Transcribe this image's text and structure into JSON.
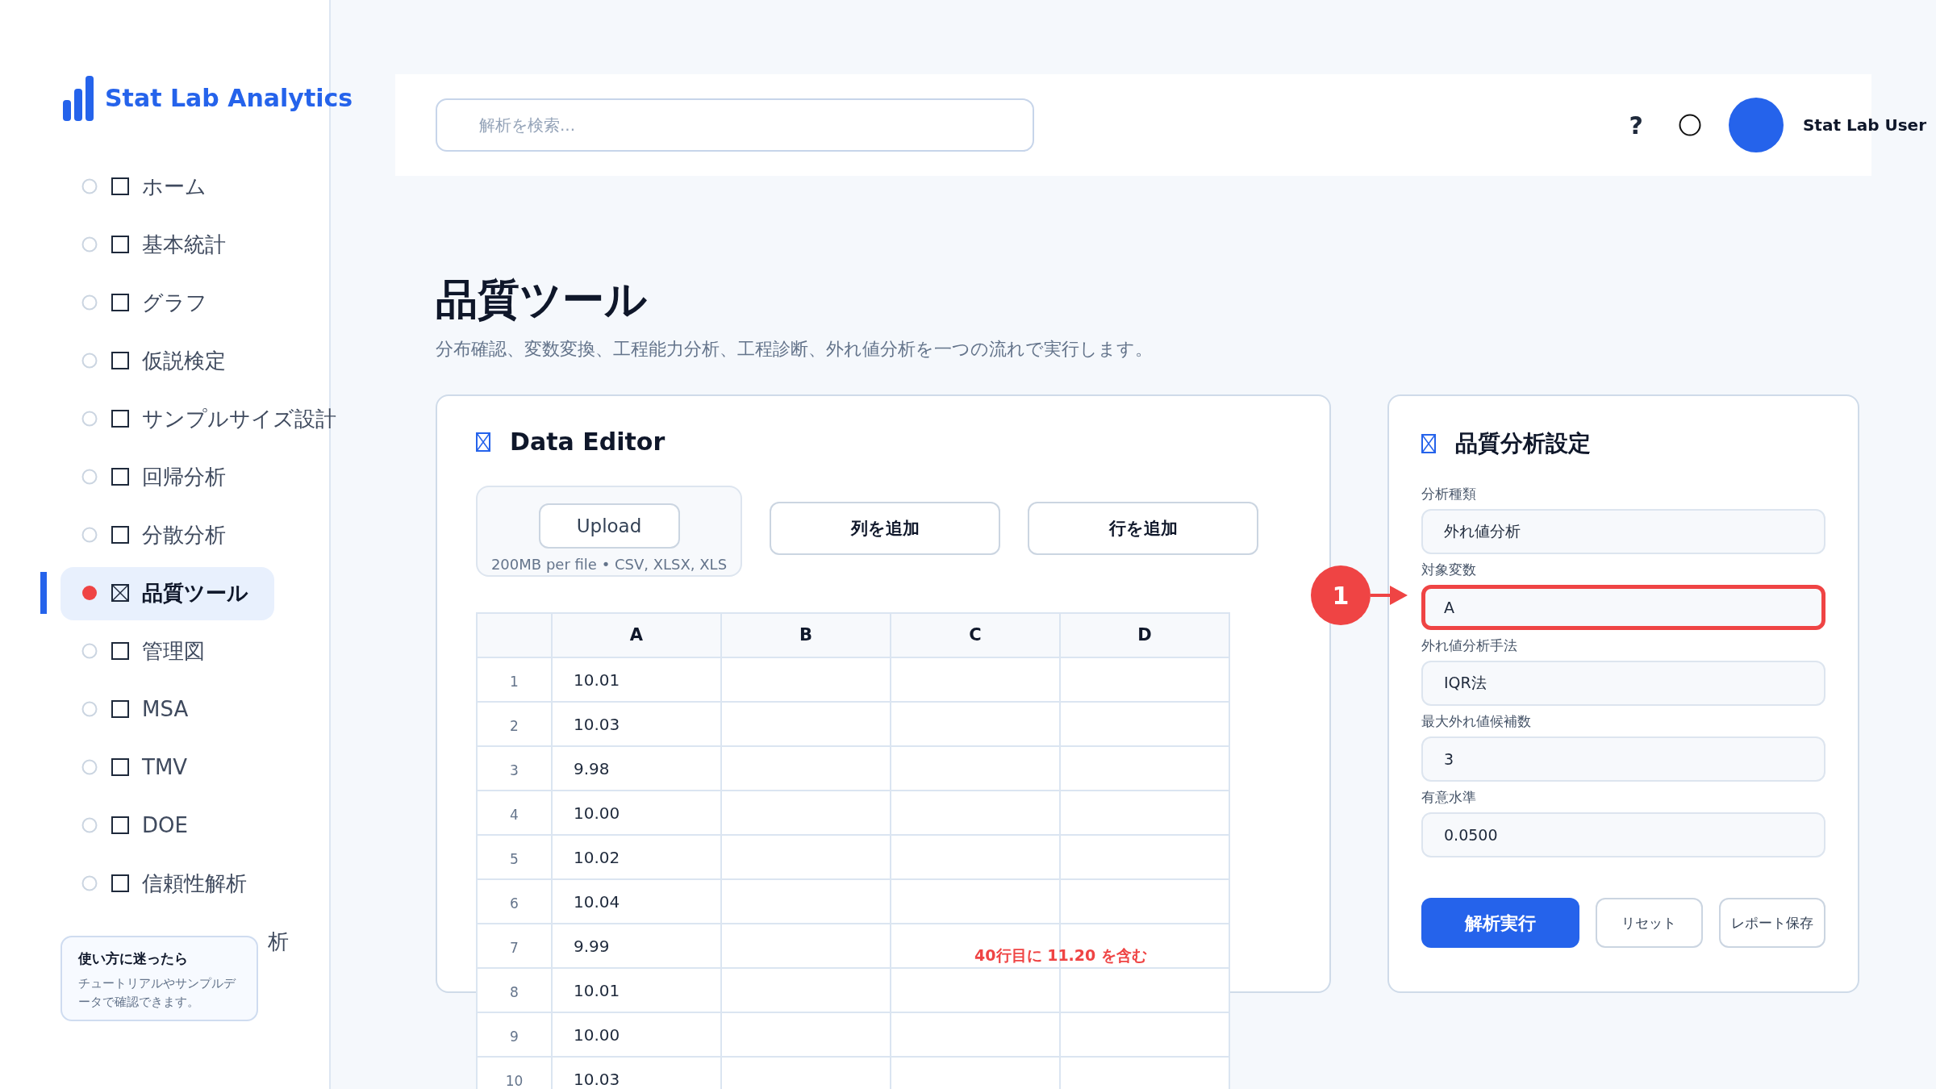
{
  "app": {
    "name": "Stat Lab Analytics"
  },
  "sidebar": {
    "items": [
      {
        "label": "ホーム",
        "selected": false
      },
      {
        "label": "基本統計",
        "selected": false
      },
      {
        "label": "グラフ",
        "selected": false
      },
      {
        "label": "仮説検定",
        "selected": false
      },
      {
        "label": "サンプルサイズ設計",
        "selected": false
      },
      {
        "label": "回帰分析",
        "selected": false
      },
      {
        "label": "分散分析",
        "selected": false
      },
      {
        "label": "品質ツール",
        "selected": true
      },
      {
        "label": "管理図",
        "selected": false
      },
      {
        "label": "MSA",
        "selected": false
      },
      {
        "label": "TMV",
        "selected": false
      },
      {
        "label": "DOE",
        "selected": false
      },
      {
        "label": "信頼性解析",
        "selected": false
      },
      {
        "label": "析",
        "selected": false,
        "covered": true
      }
    ],
    "help": {
      "title": "使い方に迷ったら",
      "text": "チュートリアルやサンプルデータで確認できます。"
    }
  },
  "topbar": {
    "search": {
      "placeholder": "解析を検索..."
    },
    "help": "?",
    "user": "Stat Lab User"
  },
  "page": {
    "title": "品質ツール",
    "subtitle": "分布確認、変数変換、工程能力分析、工程診断、外れ値分析を一つの流れで実行します。"
  },
  "editor": {
    "title": "Data Editor",
    "upload": {
      "button": "Upload",
      "hint": "200MB per file • CSV, XLSX, XLS"
    },
    "buttons": [
      "列を追加",
      "行を追加"
    ],
    "table": {
      "columns": [
        "A",
        "B",
        "C",
        "D"
      ],
      "rows": [
        {
          "n": "1",
          "cells": [
            "10.01"
          ]
        },
        {
          "n": "2",
          "cells": [
            "10.03"
          ]
        },
        {
          "n": "3",
          "cells": [
            "9.98"
          ]
        },
        {
          "n": "4",
          "cells": [
            "10.00"
          ]
        },
        {
          "n": "5",
          "cells": [
            "10.02"
          ]
        },
        {
          "n": "6",
          "cells": [
            "10.04"
          ]
        },
        {
          "n": "7",
          "cells": [
            "9.99"
          ],
          "note": "40行目に 11.20 を含む"
        },
        {
          "n": "8",
          "cells": [
            "10.01"
          ]
        },
        {
          "n": "9",
          "cells": [
            "10.00"
          ]
        },
        {
          "n": "10",
          "cells": [
            "10.03"
          ]
        }
      ]
    }
  },
  "settings": {
    "title": "品質分析設定",
    "fields": [
      {
        "label": "分析種類",
        "value": "外れ値分析",
        "highlighted": false
      },
      {
        "label": "対象変数",
        "value": "A",
        "highlighted": true
      },
      {
        "label": "外れ値分析手法",
        "value": "IQR法",
        "highlighted": false
      },
      {
        "label": "最大外れ値候補数",
        "value": "3",
        "highlighted": false
      },
      {
        "label": "有意水準",
        "value": "0.0500",
        "highlighted": false
      }
    ],
    "buttons": [
      {
        "label": "解析実行",
        "kind": "primary"
      },
      {
        "label": "リセット",
        "kind": "outline"
      },
      {
        "label": "レポート保存",
        "kind": "outline"
      }
    ]
  },
  "annotation": {
    "number": "1"
  }
}
